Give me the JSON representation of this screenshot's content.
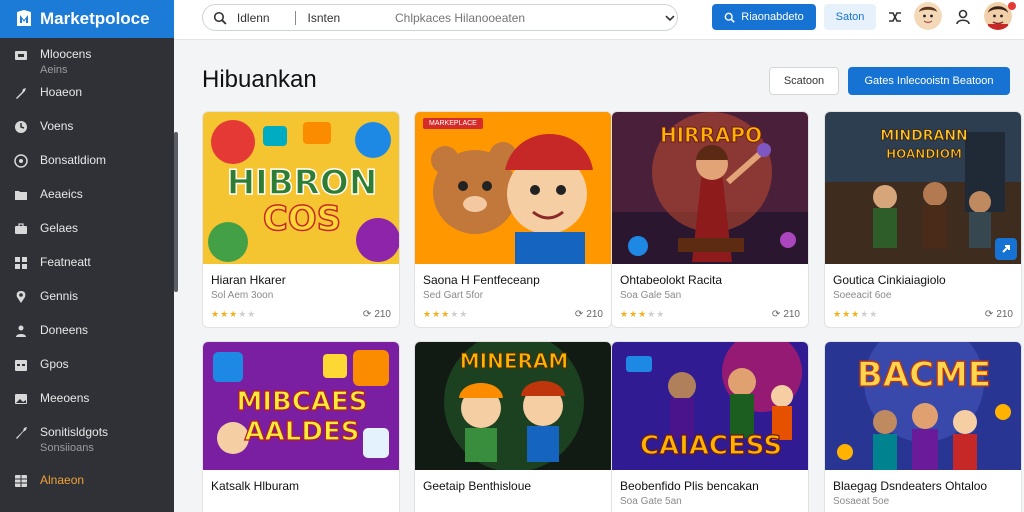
{
  "brand": {
    "name": "Marketpoloce"
  },
  "sidebar": {
    "items": [
      {
        "label": "Mloocens",
        "sub": "Aeins",
        "icon": "store-icon"
      },
      {
        "label": "Hoaeon",
        "icon": "wrench-icon"
      },
      {
        "label": "Voens",
        "icon": "clock-icon"
      },
      {
        "label": "Bonsatldiom",
        "icon": "settings-circle-icon"
      },
      {
        "label": "Aeaeics",
        "icon": "folder-icon"
      },
      {
        "label": "Gelaes",
        "icon": "briefcase-icon"
      },
      {
        "label": "Featneatt",
        "icon": "grid-icon"
      },
      {
        "label": "Gennis",
        "icon": "location-pin-icon"
      },
      {
        "label": "Doneens",
        "icon": "user-download-icon"
      },
      {
        "label": "Gpos",
        "icon": "calendar-icon"
      },
      {
        "label": "Meeoens",
        "icon": "image-icon"
      },
      {
        "label": "Sonitisldgots",
        "sub": "Sonsiioans",
        "icon": "tools-icon"
      },
      {
        "label": "Alnaeon",
        "icon": "table-icon",
        "active": true
      }
    ]
  },
  "topbar": {
    "search_cat1": "Idlenn",
    "search_cat2": "Isnten",
    "search_placeholder": "Chlpkaces Hilanooeaten",
    "primary_label": "Riaonabdeto",
    "light_label": "Saton"
  },
  "page": {
    "title": "Hibuankan",
    "secondary_button": "Scatoon",
    "cta_button": "Gates Inlecooistn Beatoon"
  },
  "cards": [
    {
      "title": "Hiaran Hkarer",
      "meta": "Sol Aem 3oon",
      "rating": 3,
      "count": "210",
      "art": "HIBRON COS",
      "tag": ""
    },
    {
      "title": "Saona H Fentfeceanp",
      "meta": "Sed Gart 5for",
      "rating": 3,
      "count": "210",
      "art": "",
      "tag": "MARKEPLACE"
    },
    {
      "title": "Ohtabeolokt Racita",
      "meta": "Soa Gale 5an",
      "rating": 3,
      "count": "210",
      "art": "HIRRAPO",
      "tag": ""
    },
    {
      "title": "Goutica Cinkiaiagiolo",
      "meta": "Soeeacit 6oe",
      "rating": 3,
      "count": "210",
      "art": "MINDRANN HOANDIOM",
      "tag": ""
    },
    {
      "title": "Katsalk Hlburam",
      "meta": "",
      "rating": 0,
      "count": "",
      "art": "MIBCAES AALDES",
      "tag": ""
    },
    {
      "title": "Geetaip Benthisloue",
      "meta": "",
      "rating": 0,
      "count": "",
      "art": "MINERAM",
      "tag": ""
    },
    {
      "title": "Beobenfido Plis bencakan",
      "meta": "Soa Gate 5an",
      "rating": 0,
      "count": "",
      "art": "CAIACESS",
      "tag": ""
    },
    {
      "title": "Blaegag Dsndeaters Ohtaloo",
      "meta": "Sosaeat 5oe",
      "rating": 0,
      "count": "",
      "art": "BACME",
      "tag": ""
    }
  ],
  "colors": {
    "brand": "#1b7bd6",
    "accent": "#1673d4",
    "sidebar": "#2f3136",
    "active": "#f0a23a",
    "star": "#f2b01e"
  }
}
